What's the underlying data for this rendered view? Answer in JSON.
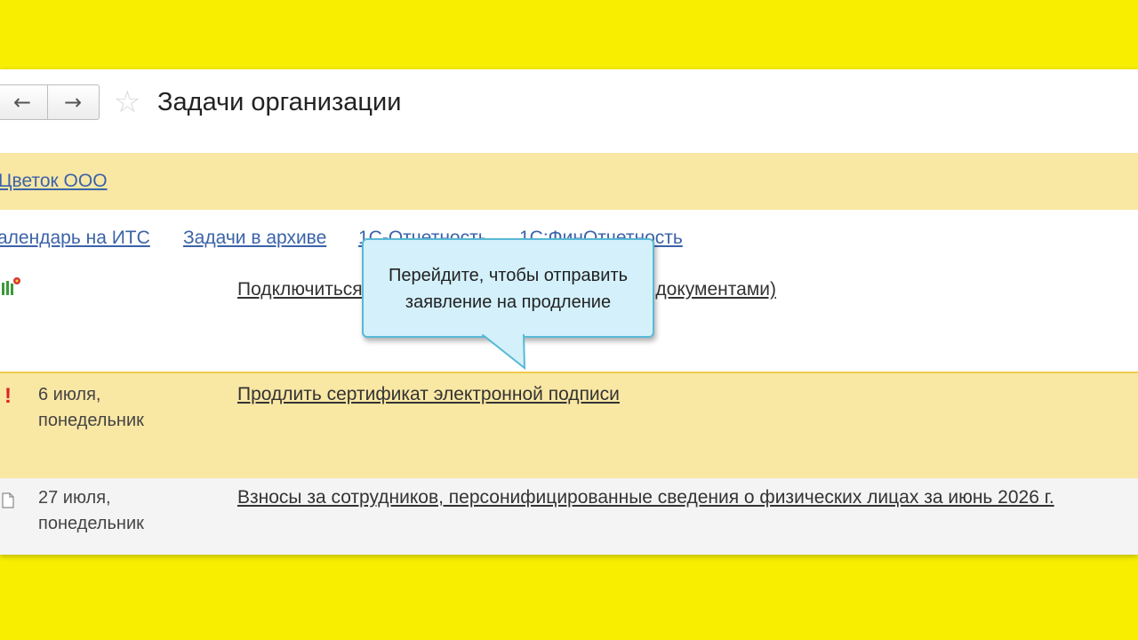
{
  "header": {
    "back_icon": "←",
    "forward_icon": "→",
    "favorite_icon": "☆",
    "title": "Задачи организации"
  },
  "organization": {
    "name": "Цветок ООО"
  },
  "links": [
    {
      "label": "алендарь на ИТС"
    },
    {
      "label": "Задачи в архиве"
    },
    {
      "label": "1С-Отчетность"
    },
    {
      "label": "1С:ФинОтчетность"
    }
  ],
  "tasks": [
    {
      "icon": "flower-icon",
      "date_line1": "",
      "date_line2": "",
      "text": "Подключиться к сервису обмена электронными документами)"
    },
    {
      "icon": "exclamation-icon",
      "icon_glyph": "!",
      "date_line1": "6 июля,",
      "date_line2": "понедельник",
      "text": "Продлить сертификат электронной подписи"
    },
    {
      "icon": "document-icon",
      "date_line1": "27 июля,",
      "date_line2": "понедельник",
      "text": "Взносы за сотрудников, персонифицированные сведения о физических лицах за июнь 2026 г."
    }
  ],
  "tooltip": {
    "line1": "Перейдите, чтобы отправить",
    "line2": "заявление на продление"
  },
  "colors": {
    "background": "#f8ef00",
    "highlight_row": "#f9e7a4",
    "link": "#3b63a8",
    "tooltip_bg": "#d3f0fb",
    "tooltip_border": "#58b9d6"
  }
}
